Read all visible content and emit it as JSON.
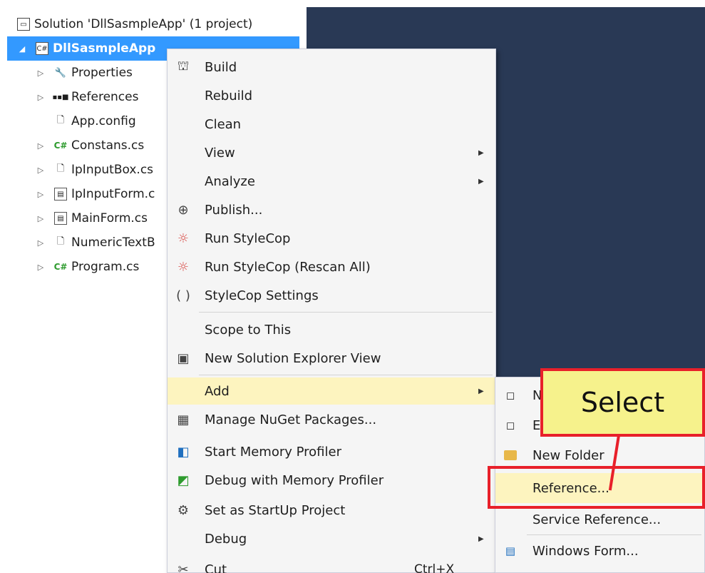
{
  "explorer": {
    "solution_label": "Solution 'DllSasmpleApp' (1 project)",
    "project_label": "DllSasmpleApp",
    "items": [
      {
        "label": "Properties",
        "icon": "wrench-icon",
        "expandable": true
      },
      {
        "label": "References",
        "icon": "references-icon",
        "expandable": true
      },
      {
        "label": "App.config",
        "icon": "config-file-icon",
        "expandable": false
      },
      {
        "label": "Constans.cs",
        "icon": "csharp-file-icon",
        "expandable": true
      },
      {
        "label": "IpInputBox.cs",
        "icon": "usercontrol-file-icon",
        "expandable": true
      },
      {
        "label": "IpInputForm.c",
        "icon": "form-file-icon",
        "expandable": true
      },
      {
        "label": "MainForm.cs",
        "icon": "form-file-icon",
        "expandable": true
      },
      {
        "label": "NumericTextB",
        "icon": "file-icon",
        "expandable": true
      },
      {
        "label": "Program.cs",
        "icon": "csharp-file-icon",
        "expandable": true
      }
    ]
  },
  "context_menu": {
    "items": [
      {
        "label": "Build",
        "icon": "build-icon"
      },
      {
        "label": "Rebuild"
      },
      {
        "label": "Clean"
      },
      {
        "label": "View",
        "submenu": true
      },
      {
        "label": "Analyze",
        "submenu": true
      },
      {
        "label": "Publish...",
        "icon": "publish-icon"
      },
      {
        "label": "Run StyleCop",
        "icon": "stylecop-icon"
      },
      {
        "label": "Run StyleCop (Rescan All)",
        "icon": "stylecop-icon"
      },
      {
        "label": "StyleCop Settings",
        "icon": "braces-icon"
      },
      {
        "label": "Scope to This"
      },
      {
        "label": "New Solution Explorer View",
        "icon": "new-view-icon"
      },
      {
        "label": "Add",
        "submenu": true,
        "highlighted": true
      },
      {
        "label": "Manage NuGet Packages...",
        "icon": "nuget-icon"
      },
      {
        "label": "Start Memory Profiler",
        "icon": "memory-profiler-icon"
      },
      {
        "label": "Debug with Memory Profiler",
        "icon": "debug-profiler-icon"
      },
      {
        "label": "Set as StartUp Project",
        "icon": "gear-icon"
      },
      {
        "label": "Debug",
        "submenu": true
      },
      {
        "label": "Cut",
        "icon": "cut-icon",
        "shortcut": "Ctrl+X"
      }
    ]
  },
  "add_submenu": {
    "items": [
      {
        "label": "N",
        "icon": "new-item-icon"
      },
      {
        "label": "E",
        "icon": "existing-item-icon"
      },
      {
        "label": "New Folder",
        "icon": "folder-icon"
      },
      {
        "label": "Reference...",
        "highlighted": true
      },
      {
        "label": "Service Reference..."
      },
      {
        "label": "Windows Form...",
        "icon": "windows-form-icon"
      }
    ]
  },
  "annotation": {
    "callout_text": "Select",
    "color": "#e8202a",
    "callout_bg": "#f6f28c"
  },
  "colors": {
    "selection": "#3399ff",
    "menu_highlight": "#fdf4bf",
    "editor_bg": "#293955"
  }
}
